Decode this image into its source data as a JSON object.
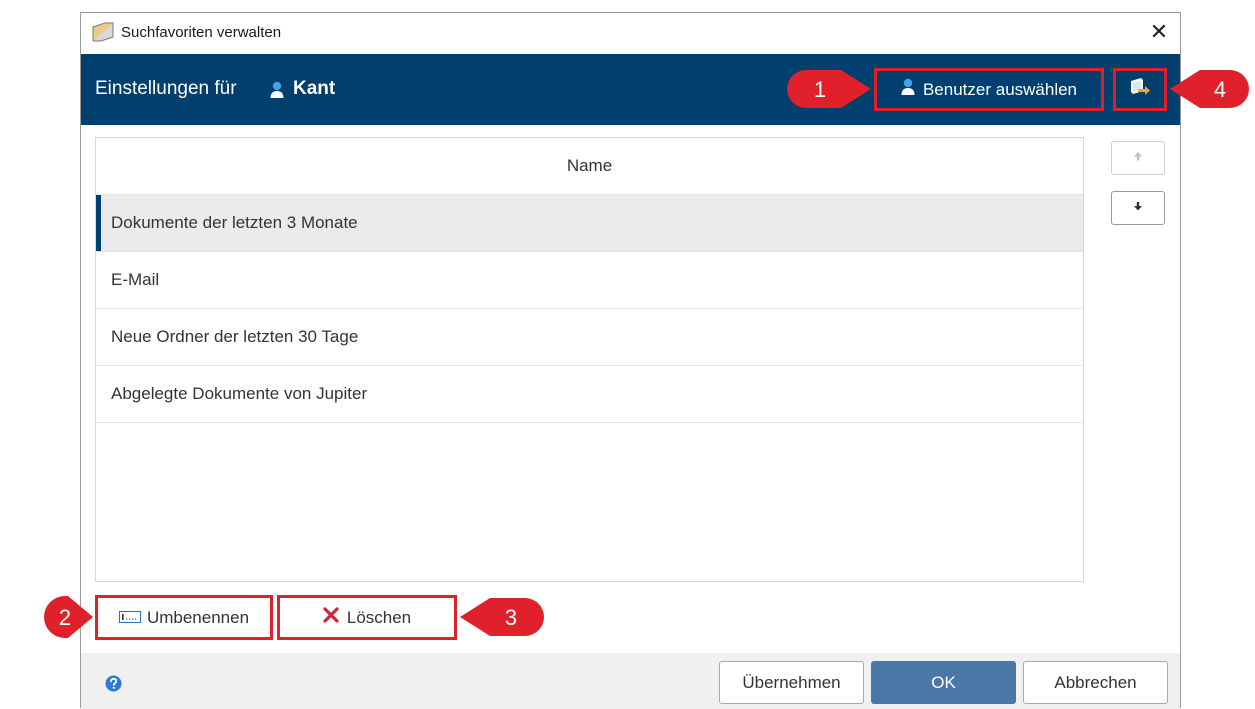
{
  "window": {
    "title": "Suchfavoriten verwalten"
  },
  "header": {
    "label": "Einstellungen für",
    "username": "Kant",
    "select_user_label": "Benutzer auswählen"
  },
  "list": {
    "column_header": "Name",
    "items": [
      {
        "label": "Dokumente der letzten 3 Monate",
        "selected": true
      },
      {
        "label": "E-Mail",
        "selected": false
      },
      {
        "label": "Neue Ordner der letzten 30 Tage",
        "selected": false
      },
      {
        "label": "Abgelegte Dokumente von Jupiter",
        "selected": false
      }
    ]
  },
  "actions": {
    "rename_label": "Umbenennen",
    "delete_label": "Löschen"
  },
  "footer": {
    "apply_label": "Übernehmen",
    "ok_label": "OK",
    "cancel_label": "Abbrechen"
  },
  "callouts": [
    "1",
    "2",
    "3",
    "4"
  ],
  "colors": {
    "header_bg": "#003f6e",
    "highlight": "#e0202a",
    "ok_button": "#4a76a8",
    "selected_row": "#ebebeb",
    "delete_icon": "#c8283c"
  },
  "icons": {
    "app": "app-icon",
    "close": "close-icon",
    "user": "user-icon",
    "export": "export-icon",
    "move_up": "arrow-up-icon",
    "move_down": "arrow-down-icon",
    "rename": "rename-icon",
    "delete": "delete-x-icon",
    "help": "help-icon"
  }
}
